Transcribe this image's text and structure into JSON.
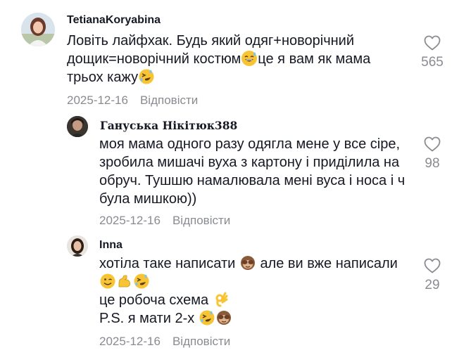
{
  "comments": [
    {
      "username": "TetianaKoryabina",
      "lines": [
        "Ловіть лайфхак. Будь який одяг+новорічний",
        "дощик=новорічний костюм",
        "це я вам як мама",
        "трьох кажу"
      ],
      "date": "2025-12-16",
      "reply_label": "Відповісти",
      "likes": "565"
    },
    {
      "username": "Гануська Нікітюк388",
      "lines": [
        "моя мама одного разу одягла мене у все сіре,",
        "зробила мишачі вуха з картону і приділила на",
        "обруч. Тушшю намалювала мені вуса і носа і ч",
        "була мишкою))"
      ],
      "date": "2025-12-16",
      "reply_label": "Відповісти",
      "likes": "98"
    },
    {
      "username": "Inna",
      "lines": [
        "хотіла таке написати",
        "але ви вже написали",
        "це робоча схема",
        "P.S. я мати 2-х"
      ],
      "date": "2025-12-16",
      "reply_label": "Відповісти",
      "likes": "29"
    }
  ],
  "icons": {
    "heart": "heart-outline-icon",
    "emoji_sweat_smile": "grinning-sweat-emoji",
    "emoji_rofl": "rolling-on-floor-laughing-emoji",
    "emoji_monkey": "see-no-evil-monkey-emoji",
    "emoji_wink": "winking-face-emoji",
    "emoji_muscle": "flexed-biceps-emoji",
    "emoji_ok": "ok-hand-emoji"
  },
  "colors": {
    "text": "#161823",
    "secondary": "#8a8b91",
    "heart_stroke": "#8a8b91"
  }
}
